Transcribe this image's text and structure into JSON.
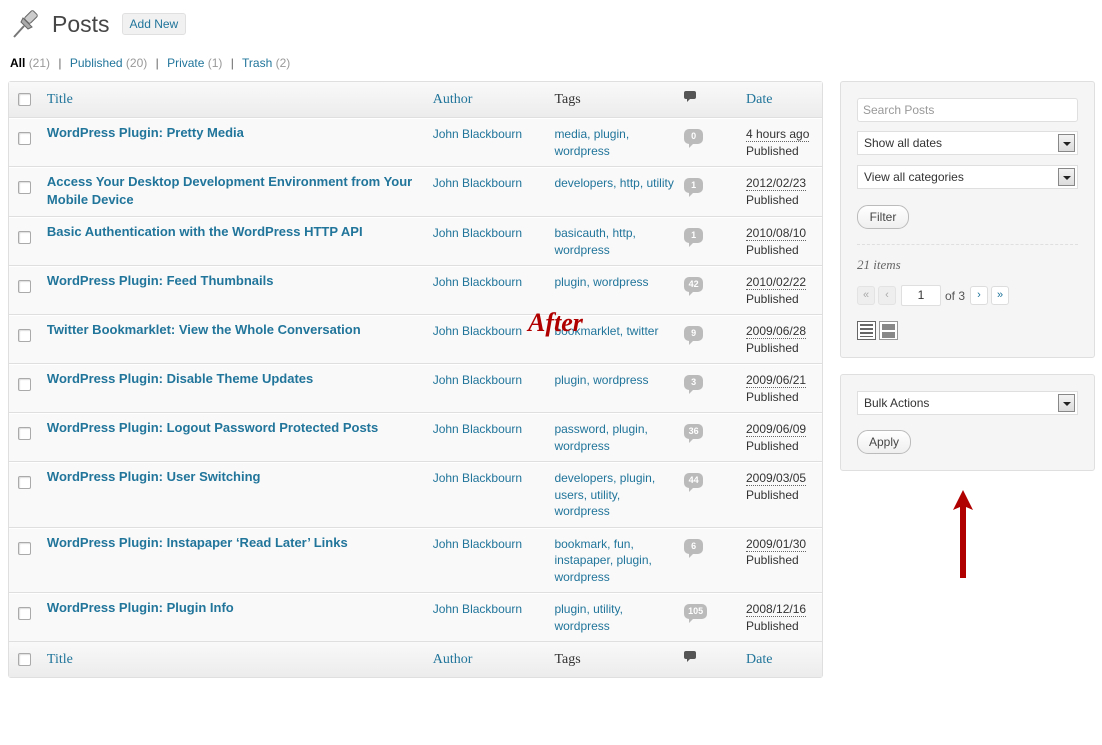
{
  "header": {
    "title": "Posts",
    "add_new": "Add New"
  },
  "views": [
    {
      "label": "All",
      "count": "(21)",
      "current": true
    },
    {
      "label": "Published",
      "count": "(20)"
    },
    {
      "label": "Private",
      "count": "(1)"
    },
    {
      "label": "Trash",
      "count": "(2)"
    }
  ],
  "table": {
    "columns": {
      "title": "Title",
      "author": "Author",
      "tags": "Tags",
      "date": "Date"
    },
    "rows": [
      {
        "title": "WordPress Plugin: Pretty Media",
        "title_lines": [
          "WordPress Plugin: Pretty Media"
        ],
        "author": "John Blackbourn",
        "tags": [
          "media, plugin,",
          "wordpress"
        ],
        "comments": "0",
        "date": "4 hours ago",
        "status": "Published"
      },
      {
        "title": "Access Your Desktop Development Environment from Your Mobile Device",
        "title_lines": [
          "Access Your Desktop Development Environment from Your",
          "Mobile Device"
        ],
        "author": "John Blackbourn",
        "tags": [
          "developers, http, utility"
        ],
        "comments": "1",
        "date": "2012/02/23",
        "status": "Published"
      },
      {
        "title": "Basic Authentication with the WordPress HTTP API",
        "title_lines": [
          "Basic Authentication with the WordPress HTTP API"
        ],
        "author": "John Blackbourn",
        "tags": [
          "basicauth, http,",
          "wordpress"
        ],
        "comments": "1",
        "date": "2010/08/10",
        "status": "Published"
      },
      {
        "title": "WordPress Plugin: Feed Thumbnails",
        "title_lines": [
          "WordPress Plugin: Feed Thumbnails"
        ],
        "author": "John Blackbourn",
        "tags": [
          "plugin, wordpress"
        ],
        "comments": "42",
        "date": "2010/02/22",
        "status": "Published"
      },
      {
        "title": "Twitter Bookmarklet: View the Whole Conversation",
        "title_lines": [
          "Twitter Bookmarklet: View the Whole Conversation"
        ],
        "author": "John Blackbourn",
        "tags": [
          "bookmarklet, twitter"
        ],
        "comments": "9",
        "date": "2009/06/28",
        "status": "Published"
      },
      {
        "title": "WordPress Plugin: Disable Theme Updates",
        "title_lines": [
          "WordPress Plugin: Disable Theme Updates"
        ],
        "author": "John Blackbourn",
        "tags": [
          "plugin, wordpress"
        ],
        "comments": "3",
        "date": "2009/06/21",
        "status": "Published"
      },
      {
        "title": "WordPress Plugin: Logout Password Protected Posts",
        "title_lines": [
          "WordPress Plugin: Logout Password Protected Posts"
        ],
        "author": "John Blackbourn",
        "tags": [
          "password, plugin,",
          "wordpress"
        ],
        "comments": "36",
        "date": "2009/06/09",
        "status": "Published"
      },
      {
        "title": "WordPress Plugin: User Switching",
        "title_lines": [
          "WordPress Plugin: User Switching"
        ],
        "author": "John Blackbourn",
        "tags": [
          "developers, plugin,",
          "users, utility,",
          "wordpress"
        ],
        "comments": "44",
        "date": "2009/03/05",
        "status": "Published"
      },
      {
        "title": "WordPress Plugin: Instapaper ‘Read Later’ Links",
        "title_lines": [
          "WordPress Plugin: Instapaper ‘Read Later’ Links"
        ],
        "author": "John Blackbourn",
        "tags": [
          "bookmark, fun,",
          "instapaper, plugin,",
          "wordpress"
        ],
        "comments": "6",
        "date": "2009/01/30",
        "status": "Published"
      },
      {
        "title": "WordPress Plugin: Plugin Info",
        "title_lines": [
          "WordPress Plugin: Plugin Info"
        ],
        "author": "John Blackbourn",
        "tags": [
          "plugin, utility,",
          "wordpress"
        ],
        "comments": "105",
        "date": "2008/12/16",
        "status": "Published"
      }
    ]
  },
  "watermark": "After",
  "filter_panel": {
    "search_placeholder": "Search Posts",
    "dates_select": "Show all dates",
    "categories_select": "View all categories",
    "filter_button": "Filter",
    "items_count": "21 items",
    "pagination": {
      "first": "«",
      "prev": "‹",
      "current_page": "1",
      "of_label": "of 3",
      "next": "›",
      "last": "»"
    }
  },
  "bulk_panel": {
    "bulk_select": "Bulk Actions",
    "apply_button": "Apply"
  },
  "colors": {
    "link": "#21759b",
    "arrow": "#b10000",
    "watermark": "#b10000",
    "bubble": "#bbbbbb"
  },
  "icons": {
    "header": "pushpin-icon",
    "comments": "comment-icon",
    "list_view": "list-view-icon",
    "excerpt_view": "excerpt-view-icon",
    "arrow": "up-arrow-icon"
  }
}
